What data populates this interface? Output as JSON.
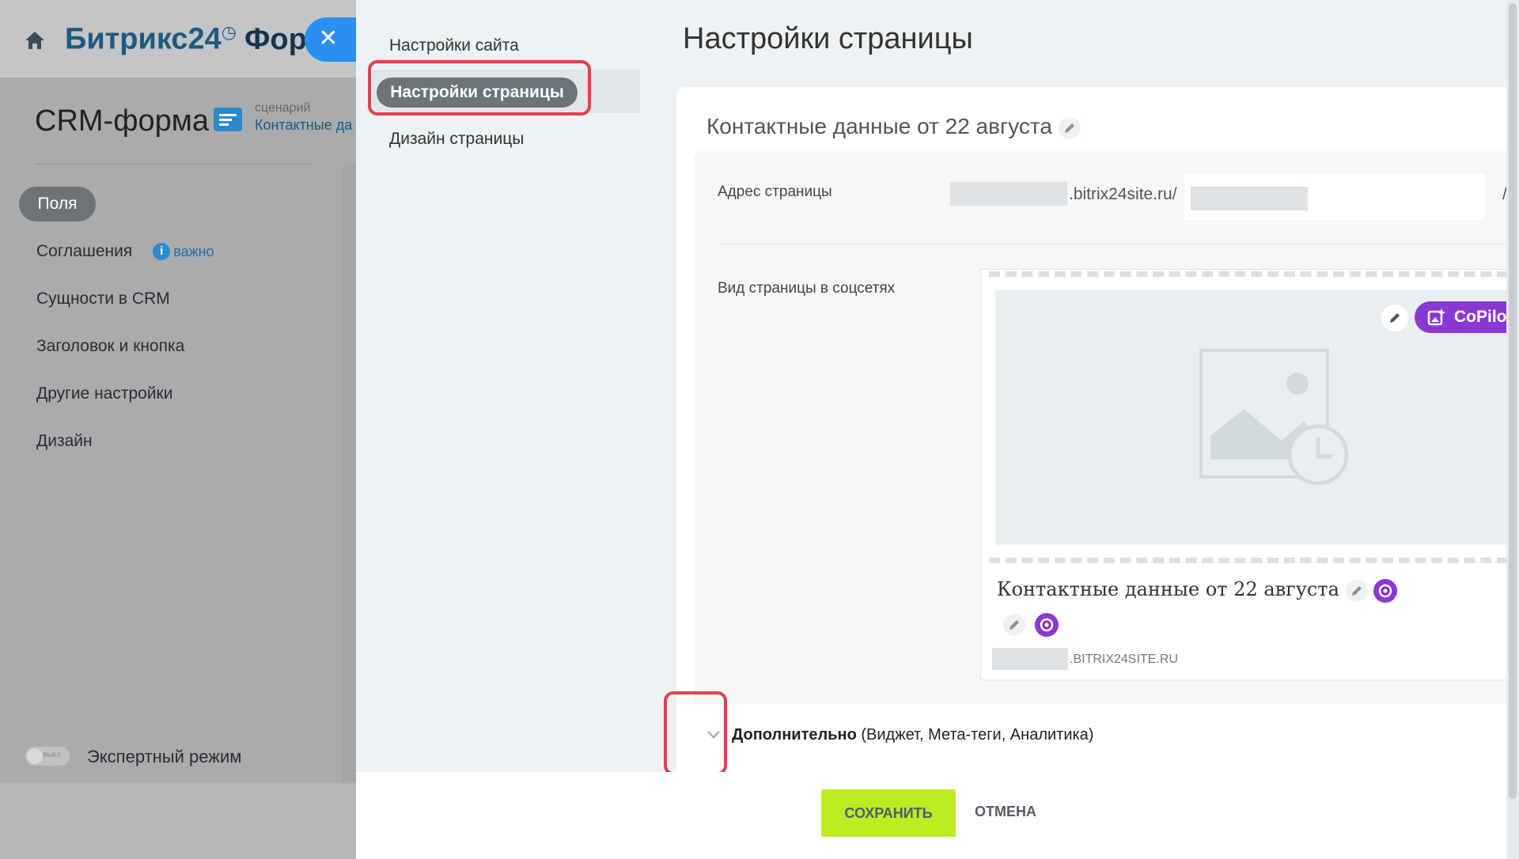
{
  "app": {
    "logo_brand": "Битрикс24",
    "logo_clock": "◷",
    "logo_section": "Формы",
    "close_label": "✕",
    "form_title": "CRM-форма",
    "scenario_label": "сценарий",
    "scenario_value": "Контактные да",
    "nav": {
      "active": "Поля",
      "items": [
        "Соглашения",
        "Сущности в CRM",
        "Заголовок и кнопка",
        "Другие настройки",
        "Дизайн"
      ],
      "important_icon": "i",
      "important_label": "важно"
    },
    "expert_toggle_state": "выкл",
    "expert_label": "Экспертный режим"
  },
  "settings": {
    "menu": {
      "site": "Настройки сайта",
      "page": "Настройки страницы",
      "design": "Дизайн страницы"
    },
    "page_title": "Настройки страницы",
    "card_title": "Контактные данные от 22 августа",
    "address": {
      "label": "Адрес страницы",
      "domain_suffix": ".bitrix24site.ru/",
      "slash": "/"
    },
    "social": {
      "label": "Вид страницы в соцсетях",
      "copilot_label": "CoPilot",
      "title": "Контактные данные от 22 августа",
      "domain_suffix": ".BITRIX24SITE.RU"
    },
    "extra": {
      "label_bold": "Дополнительно",
      "label_rest": " (Виджет,  Мета-теги,  Аналитика)"
    },
    "footer": {
      "save": "СОХРАНИТЬ",
      "cancel": "ОТМЕНА"
    }
  },
  "colors": {
    "accent_blue": "#2a8ff0",
    "highlight_red": "#e2414f",
    "save_green": "#bbed21",
    "copilot_purple": "#8a38d4"
  }
}
